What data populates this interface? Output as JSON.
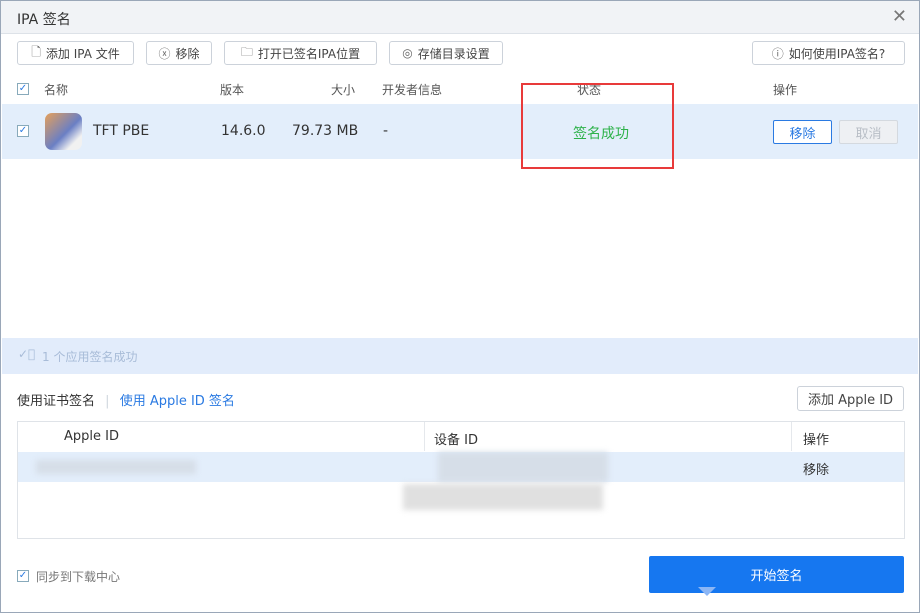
{
  "window": {
    "title": "IPA 签名",
    "close_icon": "close-icon"
  },
  "toolbar": {
    "add_ipa": "添加 IPA 文件",
    "remove": "移除",
    "open_location": "打开已签名IPA位置",
    "storage_settings": "存储目录设置",
    "help": "如何使用IPA签名?"
  },
  "table": {
    "headers": {
      "name": "名称",
      "version": "版本",
      "size": "大小",
      "developer": "开发者信息",
      "status": "状态",
      "actions": "操作"
    },
    "rows": [
      {
        "checked": true,
        "name": "TFT PBE",
        "version": "14.6.0",
        "size": "79.73 MB",
        "developer": "-",
        "status": "签名成功",
        "status_color": "#2db24a",
        "remove": "移除",
        "cancel": "取消"
      }
    ]
  },
  "status_bar": {
    "text": "1 个应用签名成功"
  },
  "sign_mode": {
    "tab_certificate": "使用证书签名",
    "tab_apple_id": "使用 Apple ID 签名",
    "add_apple_id": "添加 Apple ID"
  },
  "apple_id_table": {
    "headers": {
      "apple_id": "Apple ID",
      "device_id": "设备 ID",
      "actions": "操作"
    },
    "rows": [
      {
        "remove": "移除"
      }
    ]
  },
  "footer": {
    "sync_label": "同步到下载中心",
    "sync_checked": true,
    "start_button": "开始签名"
  },
  "colors": {
    "accent": "#1677f0",
    "success": "#2db24a",
    "highlight": "#e83a3a"
  }
}
